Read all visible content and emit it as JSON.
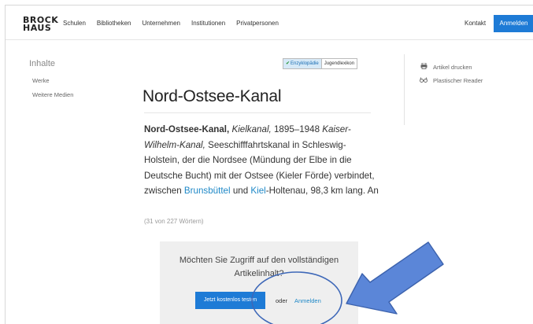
{
  "header": {
    "logo_line1": "BROCK",
    "logo_line2": "HAUS",
    "nav": [
      "Schulen",
      "Bibliotheken",
      "Unternehmen",
      "Institutionen",
      "Privatpersonen"
    ],
    "contact": "Kontakt",
    "login": "Anmelden"
  },
  "sidebar": {
    "title": "Inhalte",
    "items": [
      "Werke",
      "Weitere Medien"
    ]
  },
  "tabs": {
    "active": "Enzyklopädie",
    "other": "Jugendlexikon"
  },
  "tools": {
    "print": "Artikel drucken",
    "reader": "Plastischer Reader",
    "print_icon": "printer-icon",
    "reader_icon": "glasses-icon"
  },
  "article": {
    "title": "Nord-Ostsee-Kanal",
    "lead_bold": "Nord-Ostsee-Kanal,",
    "alt1": "Kielkanal,",
    "years": "1895–1948",
    "alt2": "Kaiser-Wilhelm-Kanal,",
    "text1": "Seeschifffahrtskanal in Schleswig-Holstein, der die Nordsee (Mündung der Elbe in die Deutsche Bucht) mit der Ostsee (Kieler Förde) verbindet, zwischen",
    "link1": "Brunsbüttel",
    "text2": "und",
    "link2": "Kiel",
    "text3": "-Holtenau, 98,3 km lang. An",
    "count": "(31 von 227 Wörtern)"
  },
  "paywall": {
    "question": "Möchten Sie Zugriff auf den vollständigen Artikelinhalt?",
    "trial_button": "Jetzt kostenlos testen",
    "or": "oder",
    "login_link": "Anmelden"
  },
  "colors": {
    "accent": "#1e7bd6",
    "link": "#1e88c7",
    "annotation_arrow": "#4f7fd0"
  }
}
